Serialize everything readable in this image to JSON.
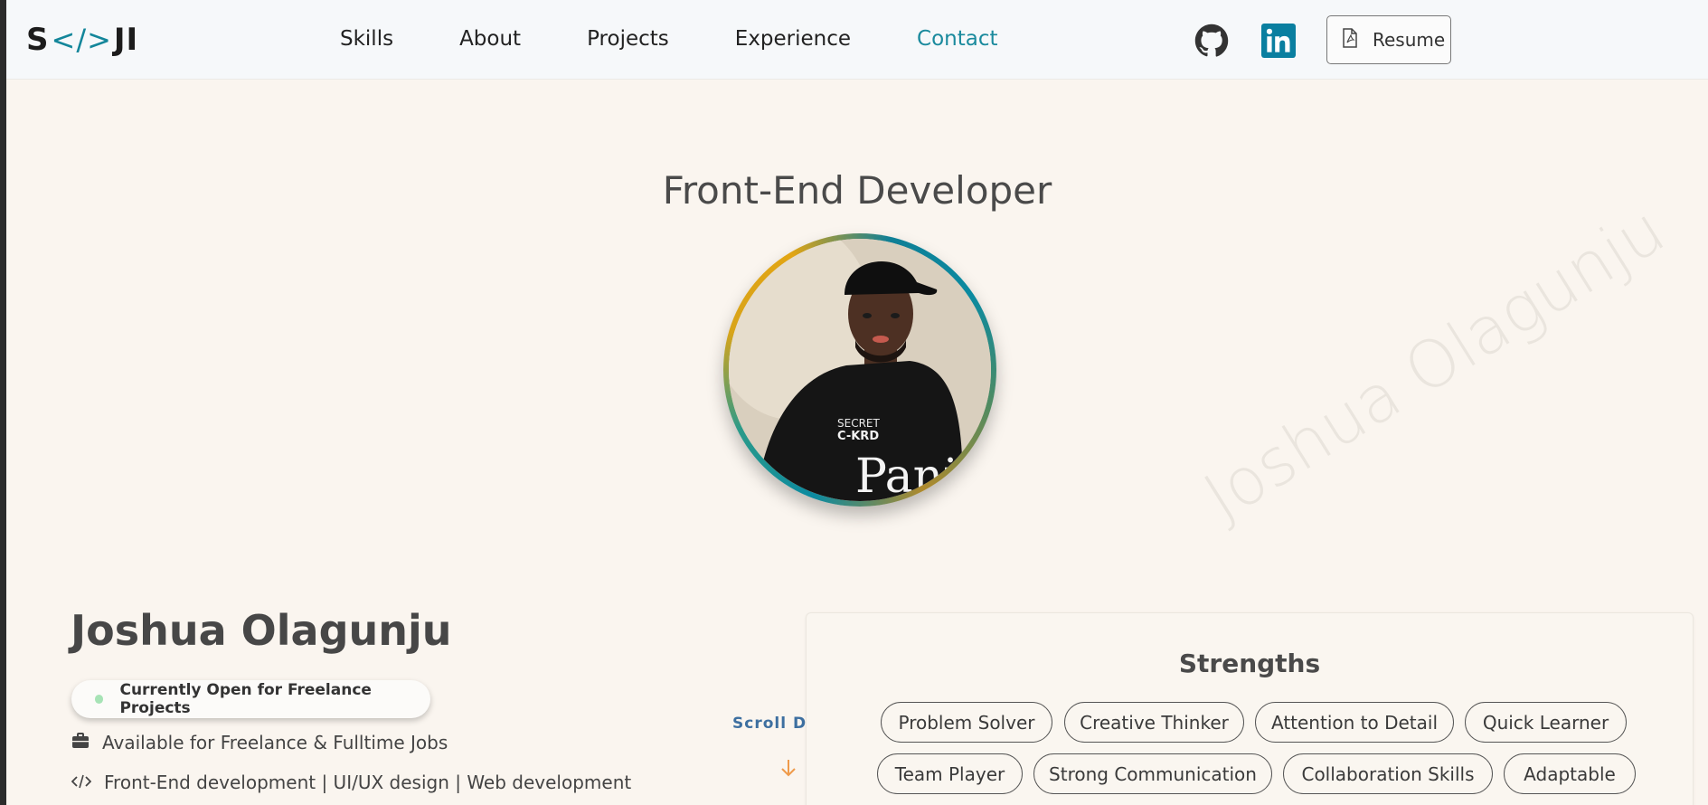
{
  "header": {
    "logo": {
      "left": "S",
      "code": "</>",
      "right": "JI"
    },
    "nav": [
      {
        "label": "Skills",
        "active": false
      },
      {
        "label": "About",
        "active": false
      },
      {
        "label": "Projects",
        "active": false
      },
      {
        "label": "Experience",
        "active": false
      },
      {
        "label": "Contact",
        "active": true
      }
    ],
    "icons": {
      "github": "github-icon",
      "linkedin": "linkedin-icon"
    },
    "resume_label": "Resume"
  },
  "hero": {
    "role": "Front-End Developer",
    "watermark": "Joshua Olagunju",
    "name": "Joshua Olagunju",
    "status": "Currently Open for Freelance Projects",
    "availability": "Available for Freelance & Fulltime Jobs",
    "specialties": "Front-End development | UI/UX design | Web development",
    "scroll_label": "Scroll Down",
    "avatar_shirt": {
      "line1": "SECRET",
      "line2": "C-KRD",
      "line3": "Panin"
    }
  },
  "strengths": {
    "title": "Strengths",
    "chips": [
      "Problem Solver",
      "Creative Thinker",
      "Attention to Detail",
      "Quick Learner",
      "Team Player",
      "Strong Communication",
      "Collaboration Skills",
      "Adaptable"
    ]
  },
  "colors": {
    "accent": "#1a8a9d",
    "page_bg": "#faf5ef",
    "header_bg": "#f6f8fa",
    "status_dot": "#a7e3b6",
    "scroll_text": "#3d6fa0",
    "scroll_arrow": "#ef9a4a",
    "linkedin": "#0a7fa0"
  }
}
